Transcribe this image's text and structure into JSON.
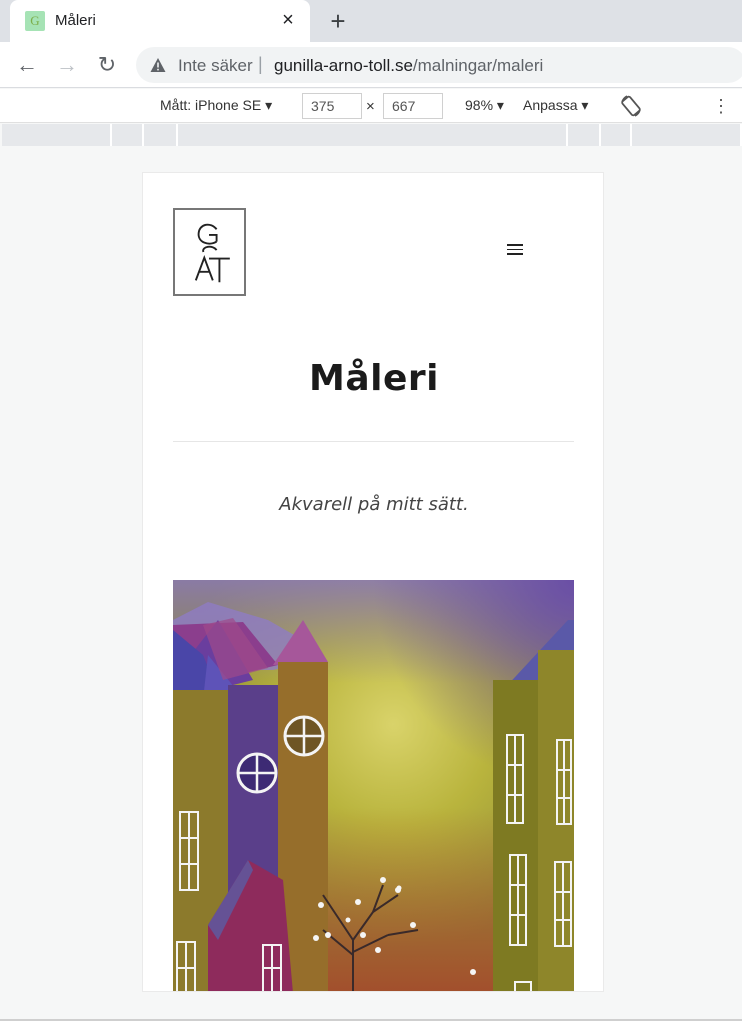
{
  "browser": {
    "tab": {
      "title": "Måleri",
      "favicon_letter": "G",
      "close_icon": "×"
    },
    "new_tab_icon": "+",
    "nav": {
      "back_icon": "←",
      "forward_icon": "→",
      "reload_icon": "↻"
    },
    "omnibox": {
      "security_label": "Inte säker",
      "separator": "|",
      "url_domain": "gunilla-arno-toll.se",
      "url_path": "/malningar/maleri"
    }
  },
  "devtools_bar": {
    "device": "Mått: iPhone SE",
    "width": "375",
    "times": "×",
    "height": "667",
    "zoom": "98%",
    "throttle": "Anpassa",
    "more_icon": "⋮"
  },
  "page": {
    "logo_letters": "G AT",
    "title": "Måleri",
    "subtitle": "Akvarell på mitt sätt."
  },
  "colors": {
    "tabstrip": "#dee1e6",
    "omnibox": "#f1f3f4",
    "page_background": "#f6f7f7",
    "title": "#1b1b1b",
    "painting_sky_top": "#7b6cb0",
    "painting_glow": "#c7c445",
    "painting_ground": "#b4592f"
  }
}
